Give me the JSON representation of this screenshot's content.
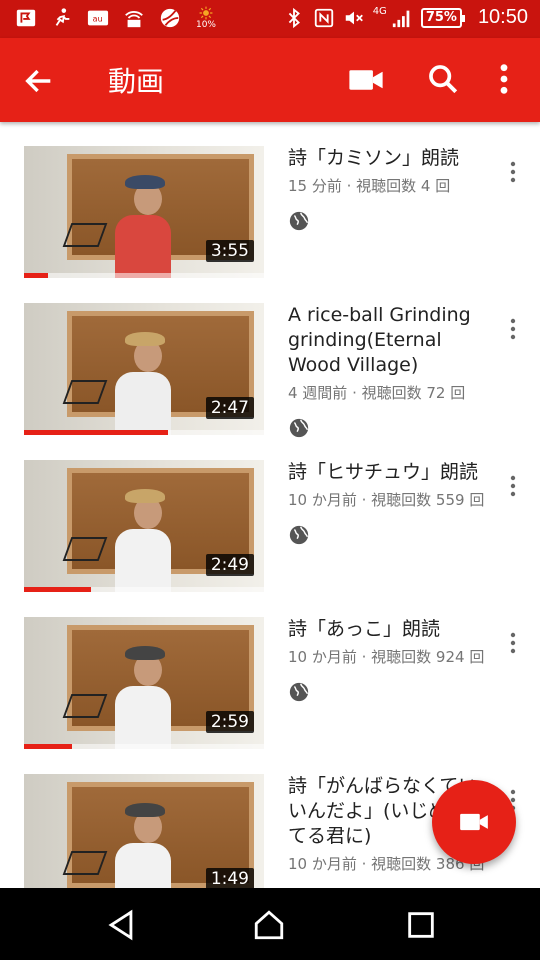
{
  "status_bar": {
    "sun_value": "10%",
    "network": "4G",
    "battery": "75%",
    "time": "10:50"
  },
  "app_bar": {
    "title": "動画"
  },
  "videos": [
    {
      "title": "詩「カミソン」朗読",
      "info": "15 分前 · 視聴回数 4 回",
      "duration": "3:55",
      "progress": 0.1
    },
    {
      "title": "A rice-ball Grinding grinding(Eternal Wood Village)",
      "info": "4 週間前 · 視聴回数 72 回",
      "duration": "2:47",
      "progress": 0.6
    },
    {
      "title": "詩「ヒサチュウ」朗読",
      "info": "10 か月前 · 視聴回数 559 回",
      "duration": "2:49",
      "progress": 0.28
    },
    {
      "title": "詩「あっこ」朗読",
      "info": "10 か月前 · 視聴回数 924 回",
      "duration": "2:59",
      "progress": 0.2
    },
    {
      "title": "詩「がんばらなくていいんだよ」(いじめられてる君に)",
      "info": "10 か月前 · 視聴回数 386 回",
      "duration": "1:49",
      "progress": 0.0
    }
  ]
}
